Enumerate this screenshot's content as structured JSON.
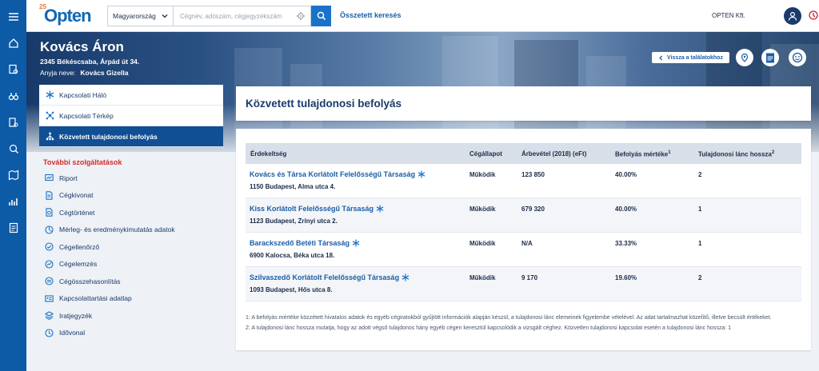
{
  "topbar": {
    "logo_anniversary": "25",
    "logo_text": "Opten",
    "country": "Magyarország",
    "search_placeholder": "Cégnév, adószám, cégjegyzékszám",
    "advanced_search": "Összetett keresés",
    "company": "OPTEN Kft."
  },
  "person": {
    "name": "Kovács Áron",
    "address": "2345 Békéscsaba, Árpád út 34.",
    "mother_label": "Anyja neve:",
    "mother_name": "Kovács Gizella"
  },
  "hero": {
    "back_button": "Vissza a találatokhoz"
  },
  "sidebar": {
    "tabs": [
      {
        "label": "Kapcsolati Háló",
        "icon": "snowflake-icon"
      },
      {
        "label": "Kapcsolati Térkép",
        "icon": "network-icon"
      },
      {
        "label": "Közvetett tulajdonosi befolyás",
        "icon": "hierarchy-icon",
        "active": true
      }
    ],
    "more_title": "További szolgáltatások",
    "services": [
      {
        "label": "Riport",
        "icon": "report-icon"
      },
      {
        "label": "Cégkivonat",
        "icon": "document-icon"
      },
      {
        "label": "Cégtörténet",
        "icon": "history-icon"
      },
      {
        "label": "Mérleg- és eredménykimutatás adatok",
        "icon": "chart-icon"
      },
      {
        "label": "Cégellenőrző",
        "icon": "check-icon"
      },
      {
        "label": "Cégelemzés",
        "icon": "analysis-icon"
      },
      {
        "label": "Cégösszehasonlítás",
        "icon": "compare-icon"
      },
      {
        "label": "Kapcsolattartási adatlap",
        "icon": "contact-card-icon"
      },
      {
        "label": "Iratjegyzék",
        "icon": "layers-icon"
      },
      {
        "label": "Idővonal",
        "icon": "timeline-icon"
      }
    ]
  },
  "main": {
    "title": "Közvetett tulajdonosi befolyás",
    "columns": {
      "interest": "Érdekeltség",
      "status": "Cégállapot",
      "revenue": "Árbevétel (2018) (eFt)",
      "influence": "Befolyás mértéke",
      "influence_sup": "1",
      "chain": "Tulajdonosi lánc hossza",
      "chain_sup": "2"
    },
    "rows": [
      {
        "name": "Kovács és Társa Korlátolt Felelősségű Társaság",
        "address": "1150 Budapest, Alma utca 4.",
        "status": "Működik",
        "revenue": "123 850",
        "influence": "40.00%",
        "chain": "2"
      },
      {
        "name": "Kiss Korlátolt Felelősségű Társaság",
        "address": "1123 Budapest, Zrínyi utca 2.",
        "status": "Működik",
        "revenue": "679 320",
        "influence": "40.00%",
        "chain": "1"
      },
      {
        "name": "Barackszedő Betéti Társaság",
        "address": "6900 Kalocsa, Béka utca 18.",
        "status": "Működik",
        "revenue": "N/A",
        "influence": "33.33%",
        "chain": "1"
      },
      {
        "name": "Szilvaszedő Korlátolt Felelősségű Társaság",
        "address": "1093 Budapest, Hős utca 8.",
        "status": "Működik",
        "revenue": "9 170",
        "influence": "19.60%",
        "chain": "2"
      }
    ],
    "footnotes": [
      "1: A befolyás mértéke közzétett hivatalos adatok és egyéb cégiratokból gyűjtött információk alapján készül, a tulajdonosi lánc elemeinek figyelembe vételével. Az adat tartalmazhat közelítő, illetve becsült értékeket.",
      "2: A tulajdonosi lánc hossza mutatja, hogy az adott végső tulajdonos hány egyéb cégen keresztül kapcsolódik a vizsgált céghez. Közvetlen tulajdonosi kapcsolat esetén a tulajdonosi lánc hossza: 1"
    ]
  },
  "colors": {
    "brand_blue": "#0d5aa7",
    "active_tab": "#114f95",
    "link": "#1a5ea8",
    "accent_red": "#d12c2c"
  }
}
